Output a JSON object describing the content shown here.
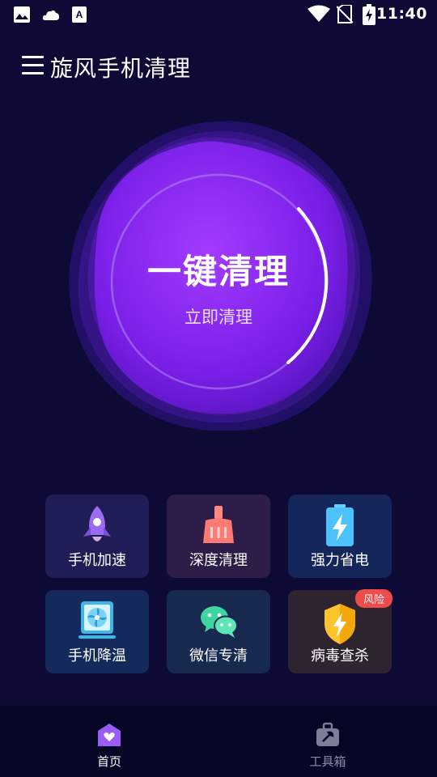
{
  "status_bar": {
    "time": "11:40",
    "left_icons": [
      "gallery-icon",
      "cloud-icon",
      "text-app-icon"
    ],
    "right_icons": [
      "wifi-icon",
      "no-sim-icon",
      "battery-charging-icon"
    ]
  },
  "app_bar": {
    "menu_icon": "hamburger-menu-icon",
    "title": "旋风手机清理"
  },
  "cleaner": {
    "main_label": "一键清理",
    "sub_label": "立即清理"
  },
  "tools": [
    {
      "label": "手机加速",
      "icon": "rocket-icon"
    },
    {
      "label": "深度清理",
      "icon": "broom-icon"
    },
    {
      "label": "强力省电",
      "icon": "battery-bolt-icon"
    },
    {
      "label": "手机降温",
      "icon": "fan-icon"
    },
    {
      "label": "微信专清",
      "icon": "wechat-icon"
    },
    {
      "label": "病毒查杀",
      "icon": "shield-bolt-icon",
      "badge": "风险"
    }
  ],
  "bottom_nav": [
    {
      "label": "首页",
      "icon": "home-heart-icon",
      "active": true
    },
    {
      "label": "工具箱",
      "icon": "toolbox-icon",
      "active": false
    }
  ],
  "colors": {
    "background": "#0d0b36",
    "accent_purple": "#8b2cf5",
    "risk_red": "#ef4b4b",
    "nav_active": "#ffffff",
    "nav_inactive": "#8c8ca8"
  }
}
